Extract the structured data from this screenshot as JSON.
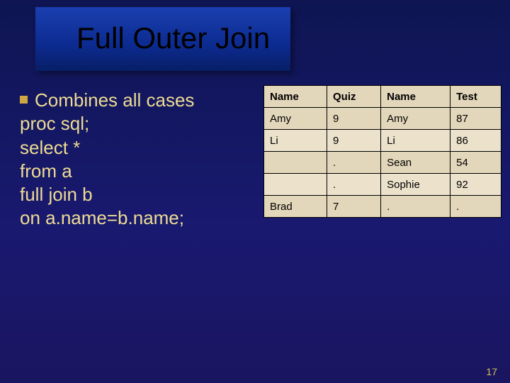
{
  "title": "Full Outer Join",
  "bullet": "Combines all cases",
  "code": {
    "l1": "proc sql;",
    "l2": "select *",
    "l3": "from a",
    "l4": "full join b",
    "l5": "on a.name=b.name;"
  },
  "table": {
    "headers": {
      "c0": "Name",
      "c1": "Quiz",
      "c2": "Name",
      "c3": "Test"
    },
    "rows": [
      {
        "c0": "Amy",
        "c1": "9",
        "c2": "Amy",
        "c3": "87"
      },
      {
        "c0": "Li",
        "c1": "9",
        "c2": "Li",
        "c3": "86"
      },
      {
        "c0": "",
        "c1": ".",
        "c2": "Sean",
        "c3": "54"
      },
      {
        "c0": "",
        "c1": ".",
        "c2": "Sophie",
        "c3": "92"
      },
      {
        "c0": "Brad",
        "c1": "7",
        "c2": ".",
        "c3": "."
      }
    ]
  },
  "page_number": "17"
}
